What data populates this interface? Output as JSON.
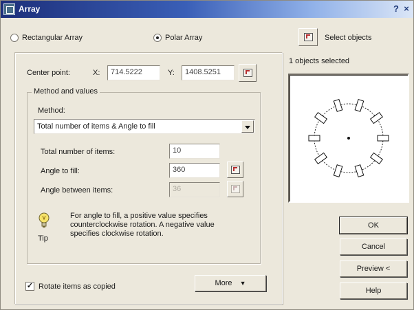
{
  "window": {
    "title": "Array",
    "help_glyph": "?",
    "close_glyph": "×"
  },
  "array_type": {
    "rectangular_label": "Rectangular Array",
    "polar_label": "Polar Array",
    "selected": "polar"
  },
  "select_objects": {
    "label": "Select objects",
    "status": "1 objects selected"
  },
  "center_point": {
    "label": "Center point:",
    "x_label": "X:",
    "x_value": "714.5222",
    "y_label": "Y:",
    "y_value": "1408.5251"
  },
  "method_group": {
    "legend": "Method and values",
    "method_label": "Method:",
    "method_value": "Total number of items & Angle to fill"
  },
  "fields": {
    "total_items_label": "Total number of items:",
    "total_items_value": "10",
    "angle_fill_label": "Angle to fill:",
    "angle_fill_value": "360",
    "angle_between_label": "Angle between items:",
    "angle_between_value": "36"
  },
  "tip": {
    "caption": "Tip",
    "line1": "For angle to fill, a positive value specifies",
    "line2": "counterclockwise rotation.  A negative value",
    "line3": "specifies clockwise rotation."
  },
  "rotate": {
    "label": "Rotate items as copied",
    "checked": true
  },
  "buttons": {
    "more": "More",
    "ok": "OK",
    "cancel": "Cancel",
    "preview": "Preview <",
    "help": "Help"
  },
  "preview_data": {
    "item_count": 10
  },
  "icons": [
    "app-icon",
    "help-icon",
    "close-icon",
    "select-objects-icon",
    "pick-point-icon",
    "pick-angle-icon",
    "tip-bulb-icon",
    "chevron-down-icon"
  ]
}
